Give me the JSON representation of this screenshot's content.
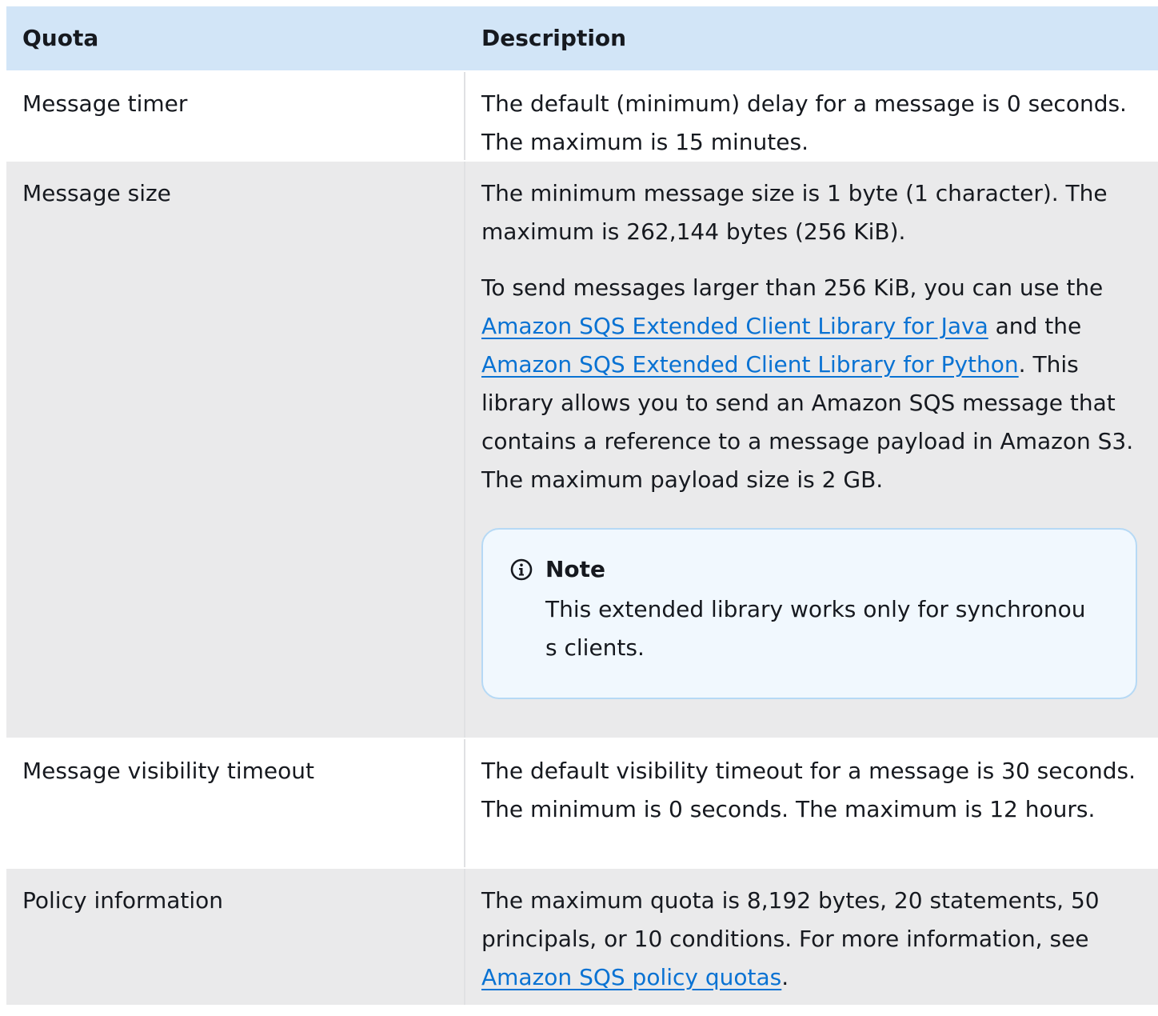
{
  "headers": {
    "quota": "Quota",
    "description": "Description"
  },
  "rows": [
    {
      "quota": "Message timer",
      "description": "The default (minimum) delay for a message is 0 seconds. The maximum is 15 minutes."
    },
    {
      "quota": "Message size",
      "p1": "The minimum message size is 1 byte (1 character). The maximum is 262,144 bytes (256 KiB).",
      "p2_a": "To send messages larger than 256 KiB, you can use the ",
      "link_java": "Amazon SQS Extended Client Library for Java",
      "p2_b": " and the ",
      "link_python": "Amazon SQS Extended Client Library for Python",
      "p2_c": ". This library allows you to send an Amazon SQS message that contains a reference to a message payload in Amazon S3. The maximum payload size is 2 GB.",
      "note_title": "Note",
      "note_text": "This extended library works only for synchronous clients."
    },
    {
      "quota": "Message visibility timeout",
      "description": "The default visibility timeout for a message is 30 seconds. The minimum is 0 seconds. The maximum is 12 hours."
    },
    {
      "quota": "Policy information",
      "d_a": "The maximum quota is 8,192 bytes, 20 statements, 50 principals, or 10 conditions. For more information, see ",
      "link_policy": "Amazon SQS policy quotas",
      "d_b": "."
    }
  ],
  "colors": {
    "header_bg": "#d2e5f7",
    "alt_row_bg": "#eaeaeb",
    "link": "#0972d3",
    "note_border": "#b6d9f5",
    "note_bg": "#f1f8fe"
  },
  "icons": {
    "note": "info-circle-icon"
  }
}
